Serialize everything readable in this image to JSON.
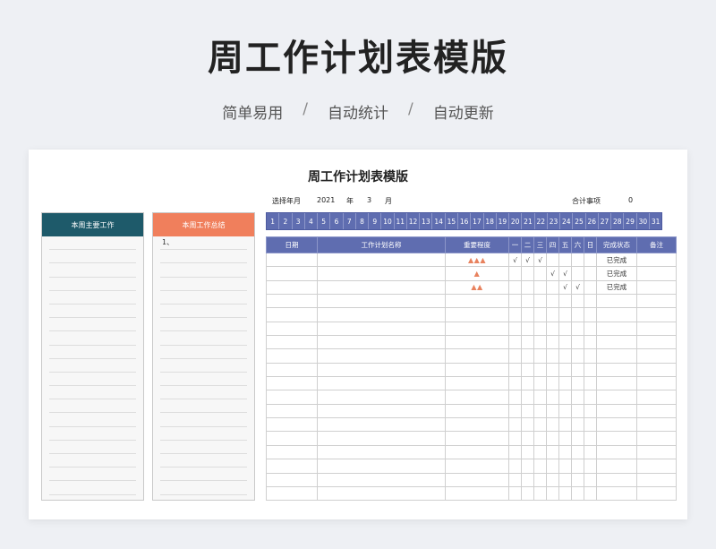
{
  "hero": {
    "title": "周工作计划表模版",
    "tags": [
      "简单易用",
      "自动统计",
      "自动更新"
    ],
    "separator": "/"
  },
  "sheet": {
    "title": "周工作计划表模版",
    "year_label": "选择年月",
    "year": "2021",
    "year_unit": "年",
    "month": "3",
    "month_unit": "月",
    "total_label": "合计事项",
    "total_value": "0"
  },
  "panels": {
    "main_work": {
      "title": "本周主要工作",
      "color": "#1e5a6a",
      "items": []
    },
    "summary": {
      "title": "本周工作总结",
      "color": "#f07f5c",
      "items": [
        "1、"
      ]
    }
  },
  "days": [
    "1",
    "2",
    "3",
    "4",
    "5",
    "6",
    "7",
    "8",
    "9",
    "10",
    "11",
    "12",
    "13",
    "14",
    "15",
    "16",
    "17",
    "18",
    "19",
    "20",
    "21",
    "22",
    "23",
    "24",
    "25",
    "26",
    "27",
    "28",
    "29",
    "30",
    "31"
  ],
  "table": {
    "headers": [
      "日期",
      "工作计划名称",
      "重要程度",
      "一",
      "二",
      "三",
      "四",
      "五",
      "六",
      "日",
      "完成状态",
      "备注"
    ],
    "rows": [
      {
        "importance": "▲▲▲",
        "checks": [
          "√",
          "√",
          "√",
          "",
          "",
          "",
          ""
        ],
        "status": "已完成"
      },
      {
        "importance": "▲",
        "checks": [
          "",
          "",
          "",
          "√",
          "√",
          "",
          ""
        ],
        "status": "已完成"
      },
      {
        "importance": "▲▲",
        "checks": [
          "",
          "",
          "",
          "",
          "√",
          "√",
          ""
        ],
        "status": "已完成"
      }
    ],
    "empty_rows": 15
  },
  "colors": {
    "header_blue": "#5f6db0",
    "triangle": "#e8825e"
  }
}
